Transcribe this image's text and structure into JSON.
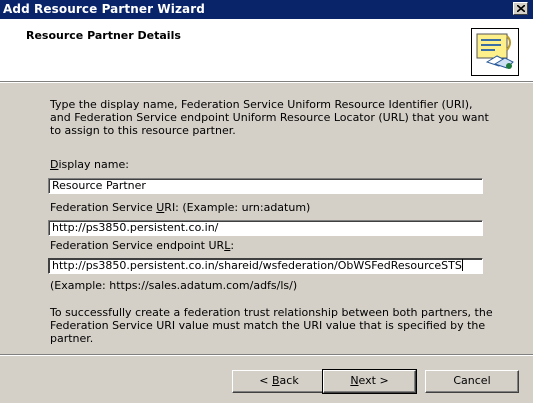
{
  "window": {
    "title": "Add Resource Partner Wizard"
  },
  "header": {
    "title": "Resource Partner Details"
  },
  "description": "Type the display name, Federation Service Uniform Resource Identifier (URI), and Federation Service endpoint Uniform Resource Locator (URL) that you want to assign to this resource partner.",
  "display_name": {
    "label_mnemonic": "D",
    "label_rest": "isplay name:",
    "value": "Resource Partner"
  },
  "service_uri": {
    "label_before": "Federation Service ",
    "label_mnemonic": "U",
    "label_after": "RI:  (Example: urn:adatum)",
    "value": "http://ps3850.persistent.co.in/"
  },
  "endpoint_url": {
    "label_before": "Federation Service endpoint UR",
    "label_mnemonic": "L",
    "label_after": ":",
    "value": "http://ps3850.persistent.co.in/shareid/wsfederation/ObWSFedResourceSTS",
    "example": "(Example: https://sales.adatum.com/adfs/ls/)"
  },
  "note": "To successfully create a federation trust relationship between both partners, the Federation Service URI value must match the URI value that is specified by the partner.",
  "buttons": {
    "back_prefix": "< ",
    "back_mnemonic": "B",
    "back_rest": "ack",
    "next_mnemonic": "N",
    "next_rest": "ext >",
    "cancel": "Cancel"
  }
}
